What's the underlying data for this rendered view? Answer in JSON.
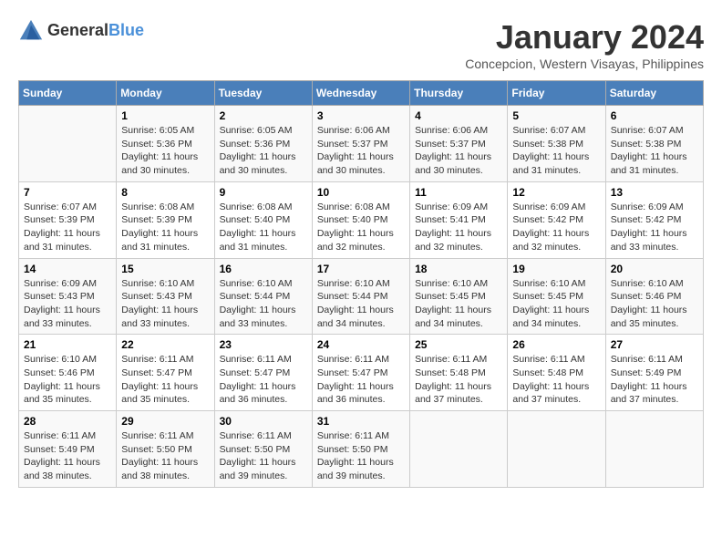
{
  "logo": {
    "general": "General",
    "blue": "Blue"
  },
  "title": "January 2024",
  "subtitle": "Concepcion, Western Visayas, Philippines",
  "days_of_week": [
    "Sunday",
    "Monday",
    "Tuesday",
    "Wednesday",
    "Thursday",
    "Friday",
    "Saturday"
  ],
  "weeks": [
    [
      {
        "day": "",
        "sunrise": "",
        "sunset": "",
        "daylight": ""
      },
      {
        "day": "1",
        "sunrise": "Sunrise: 6:05 AM",
        "sunset": "Sunset: 5:36 PM",
        "daylight": "Daylight: 11 hours and 30 minutes."
      },
      {
        "day": "2",
        "sunrise": "Sunrise: 6:05 AM",
        "sunset": "Sunset: 5:36 PM",
        "daylight": "Daylight: 11 hours and 30 minutes."
      },
      {
        "day": "3",
        "sunrise": "Sunrise: 6:06 AM",
        "sunset": "Sunset: 5:37 PM",
        "daylight": "Daylight: 11 hours and 30 minutes."
      },
      {
        "day": "4",
        "sunrise": "Sunrise: 6:06 AM",
        "sunset": "Sunset: 5:37 PM",
        "daylight": "Daylight: 11 hours and 30 minutes."
      },
      {
        "day": "5",
        "sunrise": "Sunrise: 6:07 AM",
        "sunset": "Sunset: 5:38 PM",
        "daylight": "Daylight: 11 hours and 31 minutes."
      },
      {
        "day": "6",
        "sunrise": "Sunrise: 6:07 AM",
        "sunset": "Sunset: 5:38 PM",
        "daylight": "Daylight: 11 hours and 31 minutes."
      }
    ],
    [
      {
        "day": "7",
        "sunrise": "Sunrise: 6:07 AM",
        "sunset": "Sunset: 5:39 PM",
        "daylight": "Daylight: 11 hours and 31 minutes."
      },
      {
        "day": "8",
        "sunrise": "Sunrise: 6:08 AM",
        "sunset": "Sunset: 5:39 PM",
        "daylight": "Daylight: 11 hours and 31 minutes."
      },
      {
        "day": "9",
        "sunrise": "Sunrise: 6:08 AM",
        "sunset": "Sunset: 5:40 PM",
        "daylight": "Daylight: 11 hours and 31 minutes."
      },
      {
        "day": "10",
        "sunrise": "Sunrise: 6:08 AM",
        "sunset": "Sunset: 5:40 PM",
        "daylight": "Daylight: 11 hours and 32 minutes."
      },
      {
        "day": "11",
        "sunrise": "Sunrise: 6:09 AM",
        "sunset": "Sunset: 5:41 PM",
        "daylight": "Daylight: 11 hours and 32 minutes."
      },
      {
        "day": "12",
        "sunrise": "Sunrise: 6:09 AM",
        "sunset": "Sunset: 5:42 PM",
        "daylight": "Daylight: 11 hours and 32 minutes."
      },
      {
        "day": "13",
        "sunrise": "Sunrise: 6:09 AM",
        "sunset": "Sunset: 5:42 PM",
        "daylight": "Daylight: 11 hours and 33 minutes."
      }
    ],
    [
      {
        "day": "14",
        "sunrise": "Sunrise: 6:09 AM",
        "sunset": "Sunset: 5:43 PM",
        "daylight": "Daylight: 11 hours and 33 minutes."
      },
      {
        "day": "15",
        "sunrise": "Sunrise: 6:10 AM",
        "sunset": "Sunset: 5:43 PM",
        "daylight": "Daylight: 11 hours and 33 minutes."
      },
      {
        "day": "16",
        "sunrise": "Sunrise: 6:10 AM",
        "sunset": "Sunset: 5:44 PM",
        "daylight": "Daylight: 11 hours and 33 minutes."
      },
      {
        "day": "17",
        "sunrise": "Sunrise: 6:10 AM",
        "sunset": "Sunset: 5:44 PM",
        "daylight": "Daylight: 11 hours and 34 minutes."
      },
      {
        "day": "18",
        "sunrise": "Sunrise: 6:10 AM",
        "sunset": "Sunset: 5:45 PM",
        "daylight": "Daylight: 11 hours and 34 minutes."
      },
      {
        "day": "19",
        "sunrise": "Sunrise: 6:10 AM",
        "sunset": "Sunset: 5:45 PM",
        "daylight": "Daylight: 11 hours and 34 minutes."
      },
      {
        "day": "20",
        "sunrise": "Sunrise: 6:10 AM",
        "sunset": "Sunset: 5:46 PM",
        "daylight": "Daylight: 11 hours and 35 minutes."
      }
    ],
    [
      {
        "day": "21",
        "sunrise": "Sunrise: 6:10 AM",
        "sunset": "Sunset: 5:46 PM",
        "daylight": "Daylight: 11 hours and 35 minutes."
      },
      {
        "day": "22",
        "sunrise": "Sunrise: 6:11 AM",
        "sunset": "Sunset: 5:47 PM",
        "daylight": "Daylight: 11 hours and 35 minutes."
      },
      {
        "day": "23",
        "sunrise": "Sunrise: 6:11 AM",
        "sunset": "Sunset: 5:47 PM",
        "daylight": "Daylight: 11 hours and 36 minutes."
      },
      {
        "day": "24",
        "sunrise": "Sunrise: 6:11 AM",
        "sunset": "Sunset: 5:47 PM",
        "daylight": "Daylight: 11 hours and 36 minutes."
      },
      {
        "day": "25",
        "sunrise": "Sunrise: 6:11 AM",
        "sunset": "Sunset: 5:48 PM",
        "daylight": "Daylight: 11 hours and 37 minutes."
      },
      {
        "day": "26",
        "sunrise": "Sunrise: 6:11 AM",
        "sunset": "Sunset: 5:48 PM",
        "daylight": "Daylight: 11 hours and 37 minutes."
      },
      {
        "day": "27",
        "sunrise": "Sunrise: 6:11 AM",
        "sunset": "Sunset: 5:49 PM",
        "daylight": "Daylight: 11 hours and 37 minutes."
      }
    ],
    [
      {
        "day": "28",
        "sunrise": "Sunrise: 6:11 AM",
        "sunset": "Sunset: 5:49 PM",
        "daylight": "Daylight: 11 hours and 38 minutes."
      },
      {
        "day": "29",
        "sunrise": "Sunrise: 6:11 AM",
        "sunset": "Sunset: 5:50 PM",
        "daylight": "Daylight: 11 hours and 38 minutes."
      },
      {
        "day": "30",
        "sunrise": "Sunrise: 6:11 AM",
        "sunset": "Sunset: 5:50 PM",
        "daylight": "Daylight: 11 hours and 39 minutes."
      },
      {
        "day": "31",
        "sunrise": "Sunrise: 6:11 AM",
        "sunset": "Sunset: 5:50 PM",
        "daylight": "Daylight: 11 hours and 39 minutes."
      },
      {
        "day": "",
        "sunrise": "",
        "sunset": "",
        "daylight": ""
      },
      {
        "day": "",
        "sunrise": "",
        "sunset": "",
        "daylight": ""
      },
      {
        "day": "",
        "sunrise": "",
        "sunset": "",
        "daylight": ""
      }
    ]
  ]
}
